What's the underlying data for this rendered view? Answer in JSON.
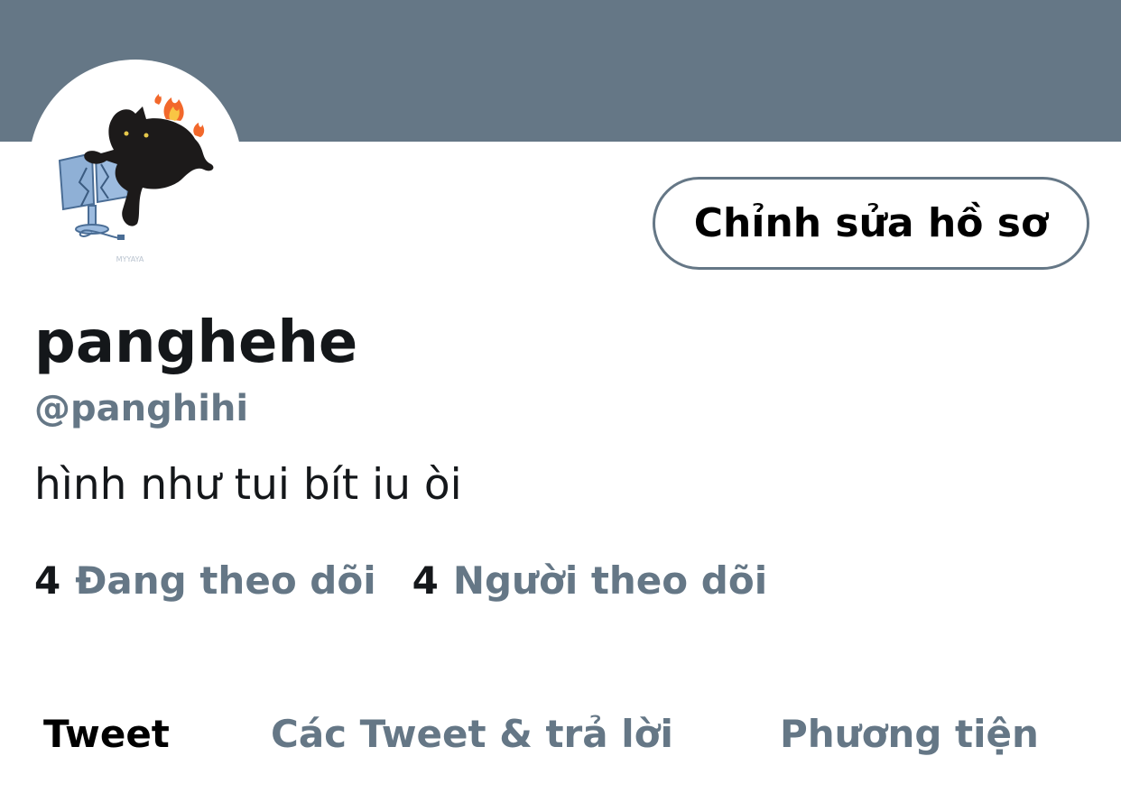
{
  "profile": {
    "display_name": "panghehe",
    "handle": "@panghihi",
    "bio": "hình như tui bít iu òi",
    "edit_button_label": "Chỉnh sửa hồ sơ",
    "avatar_icon": "black-cat-kicking-monitor-avatar",
    "avatar_watermark": "MYYAYA"
  },
  "stats": {
    "following_count": "4",
    "following_label": "Đang theo dõi",
    "followers_count": "4",
    "followers_label": "Người theo dõi"
  },
  "tabs": [
    {
      "label": "Tweet",
      "active": true
    },
    {
      "label": "Các Tweet & trả lời",
      "active": false
    },
    {
      "label": "Phương tiện",
      "active": false
    }
  ],
  "colors": {
    "banner": "#657786",
    "primary_text": "#14171a",
    "secondary_text": "#657786",
    "background": "#ffffff"
  }
}
